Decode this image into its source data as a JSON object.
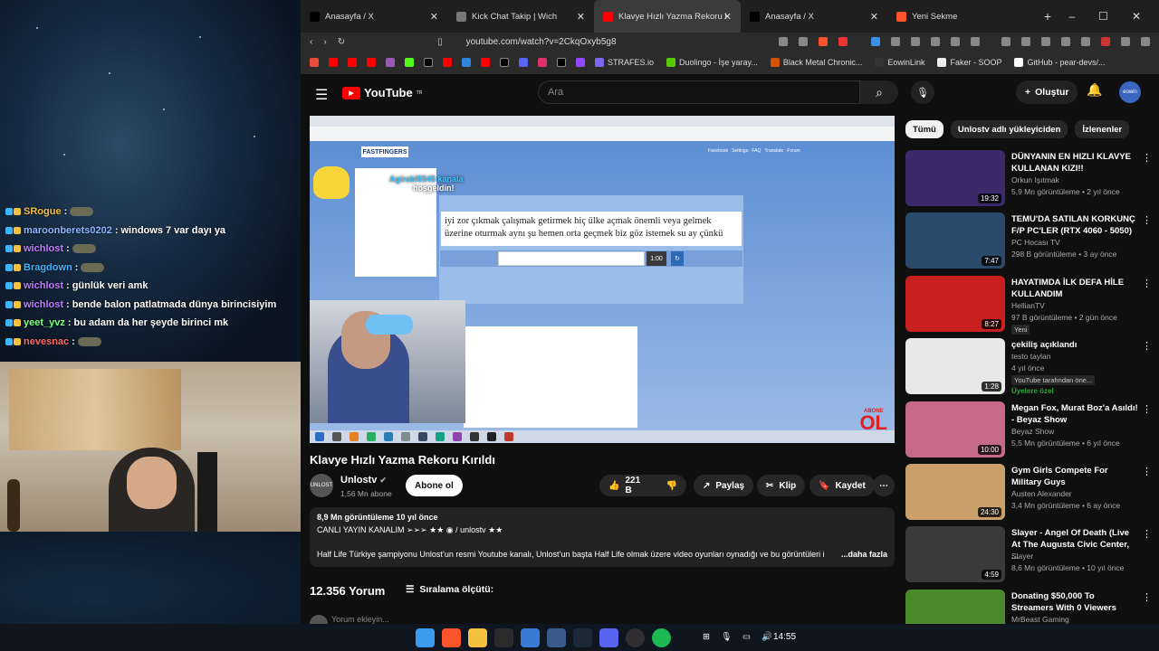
{
  "stream": {
    "chat": [
      {
        "user": "SRogue",
        "color": "#f3c13f",
        "message": "",
        "emote": true
      },
      {
        "user": "maroonberets0202",
        "color": "#8fb5ff",
        "message": "windows 7 var dayı ya",
        "emote": false
      },
      {
        "user": "wichlost",
        "color": "#c07cff",
        "message": "",
        "emote": true
      },
      {
        "user": "Bragdown",
        "color": "#3fb5ff",
        "message": "",
        "emote": true
      },
      {
        "user": "wichlost",
        "color": "#c07cff",
        "message": "günlük veri amk",
        "emote": false
      },
      {
        "user": "wichlost",
        "color": "#c07cff",
        "message": "bende balon patlatmada dünya birincisiyim",
        "emote": false
      },
      {
        "user": "yeet_yvz",
        "color": "#7fff7f",
        "message": "bu adam da her şeyde birinci mk",
        "emote": false
      },
      {
        "user": "nevesnac",
        "color": "#ff6b6b",
        "message": "",
        "emote": true
      }
    ]
  },
  "browser": {
    "tabs": [
      {
        "label": "Anasayfa / X",
        "icon": "x-icon",
        "color": "#000000"
      },
      {
        "label": "Kick Chat Takip | Wich",
        "icon": "globe-icon",
        "color": "#777777"
      },
      {
        "label": "Klavye Hızlı Yazma Rekoru Kı",
        "icon": "youtube-icon",
        "color": "#ff0000"
      },
      {
        "label": "Anasayfa / X",
        "icon": "x-icon",
        "color": "#000000"
      },
      {
        "label": "Yeni Sekme",
        "icon": "brave-icon",
        "color": "#fb542b"
      }
    ],
    "url": "youtube.com/watch?v=2CkqOxyb5g8",
    "bookmarks": [
      {
        "label": "STRAFES.io",
        "color": "#7b68ee"
      },
      {
        "label": "Duolingo - İşe yaray...",
        "color": "#58cc02"
      },
      {
        "label": "Black Metal Chronic...",
        "color": "#d35400"
      },
      {
        "label": "EowinLink",
        "color": "#333333"
      },
      {
        "label": "Faker - SOOP",
        "color": "#eeeeee"
      },
      {
        "label": "GitHub - pear-devs/...",
        "color": "#ffffff"
      }
    ]
  },
  "youtube": {
    "logo": "YouTube",
    "region": "TR",
    "search_placeholder": "Ara",
    "create_label": "Oluştur",
    "avatar_text": "eowin",
    "video": {
      "title": "Klavye Hızlı Yazma Rekoru Kırıldı",
      "typing_text": "iyi zor çıkmak çalışmak getirmek hiç ülke açmak önemli veya gelmek üzerine oturmak aynı şu hemen orta geçmek biz göz istemek su ay çünkü",
      "timer": "1:00",
      "site": "FASTFINGERS",
      "welcome_user": "Agirabl5545 kanala",
      "welcome_text": "hoşgeldin!",
      "abone_top": "ABONE",
      "abone_big": "OL"
    },
    "channel": {
      "name": "Unlostv",
      "subs": "1,56 Mn abone",
      "subscribe": "Abone ol",
      "avatar_text": "UNLOST"
    },
    "actions": {
      "likes": "221 B",
      "share": "Paylaş",
      "clip": "Klip",
      "save": "Kaydet"
    },
    "description": {
      "stats": "8,9 Mn görüntüleme  10 yıl önce",
      "line1": "CANLI YAYIN KANALIM ➢➢➢ ★★ ◉ / unlostv ★★",
      "line2": "Half Life Türkiye şampiyonu Unlost’un resmi Youtube kanalı, Unlost’un başta Half Life olmak üzere video oyunları oynadığı ve bu görüntüleri i",
      "more": "...daha fazla"
    },
    "comments": {
      "count": "12.356 Yorum",
      "sort": "Sıralama ölçütü:",
      "add": "Yorum ekleyin..."
    },
    "chips": [
      "Tümü",
      "Unlostv adlı yükleyiciden",
      "İzlenenler"
    ],
    "recommended": [
      {
        "title": "DÜNYANIN EN HIZLI KLAVYE KULLANAN KIZI!!",
        "channel": "Orkun Işıtmak",
        "meta": "5,9 Mn görüntüleme • 2 yıl önce",
        "duration": "19:32",
        "thumb": "#3a2a6a",
        "badge": "",
        "member": ""
      },
      {
        "title": "TEMU'DA SATILAN KORKUNÇ F/P PC'LER (RTX 4060 - 5050)",
        "channel": "PC Hocası TV",
        "meta": "298 B görüntüleme • 3 ay önce",
        "duration": "7:47",
        "thumb": "#2a4a6a",
        "badge": "",
        "member": ""
      },
      {
        "title": "HAYATIMDA İLK DEFA HİLE KULLANDIM",
        "channel": "HellianTV",
        "meta": "97 B görüntüleme • 2 gün önce",
        "duration": "8:27",
        "thumb": "#c82020",
        "badge": "Yeni",
        "member": ""
      },
      {
        "title": "çekiliş açıklandı",
        "channel": "testo taylan",
        "meta": "4 yıl önce",
        "duration": "1:28",
        "thumb": "#e8e8e8",
        "badge": "YouTube tarafından öne...",
        "member": "Üyelere özel"
      },
      {
        "title": "Megan Fox, Murat Boz'a Asıldı! - Beyaz Show",
        "channel": "Beyaz Show",
        "meta": "5,5 Mn görüntüleme • 6 yıl önce",
        "duration": "10:00",
        "thumb": "#c76a8a",
        "badge": "",
        "member": ""
      },
      {
        "title": "Gym Girls Compete For Military Guys",
        "channel": "Austen Alexander",
        "meta": "3,4 Mn görüntüleme • 6 ay önce",
        "duration": "24:30",
        "thumb": "#c9a06a",
        "badge": "",
        "member": ""
      },
      {
        "title": "Slayer - Angel Of Death (Live At The Augusta Civic Center, ...",
        "channel": "Slayer",
        "meta": "8,6 Mn görüntüleme • 10 yıl önce",
        "duration": "4:59",
        "thumb": "#3a3a3a",
        "badge": "",
        "member": ""
      },
      {
        "title": "Donating $50,000 To Streamers With 0 Viewers",
        "channel": "MrBeast Gaming",
        "meta": "",
        "duration": "",
        "thumb": "#4a8a2a",
        "badge": "",
        "member": ""
      }
    ]
  },
  "taskbar": {
    "time": "14:55"
  }
}
